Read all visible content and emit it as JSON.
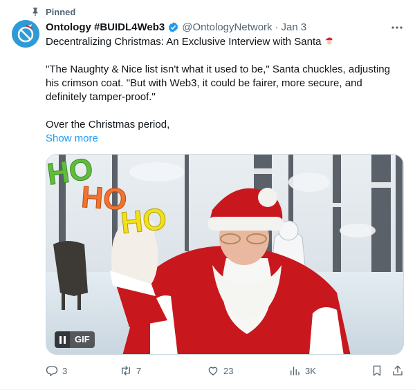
{
  "pinned": {
    "label": "Pinned",
    "icon": "pin-icon"
  },
  "author": {
    "name": "Ontology #BUIDL4Web3",
    "handle": "@OntologyNetwork",
    "separator": "·",
    "date": "Jan 3",
    "verified_color": "#1d9bf0",
    "avatar_color": "#2f9bd6"
  },
  "menu": {
    "icon": "more-icon",
    "label": "···"
  },
  "tweet": {
    "title": "Decentralizing Christmas: An Exclusive Interview with Santa",
    "title_emoji": "santa-emoji",
    "paragraph": "\"The Naughty & Nice list isn't what it used to be,\" Santa chuckles, adjusting his crimson coat. \"But with Web3, it could be fairer, more secure, and definitely tamper-proof.\"",
    "tail": "Over the Christmas period,",
    "show_more": "Show more"
  },
  "media": {
    "type": "gif",
    "overlay_text": [
      "HO",
      "HO",
      "HO"
    ],
    "gif_label": "GIF",
    "pause_icon": "pause-icon"
  },
  "actions": {
    "replies": "3",
    "reposts": "7",
    "likes": "23",
    "views": "3K"
  },
  "colors": {
    "text": "#0f1419",
    "secondary": "#536471",
    "link": "#1d9bf0"
  }
}
